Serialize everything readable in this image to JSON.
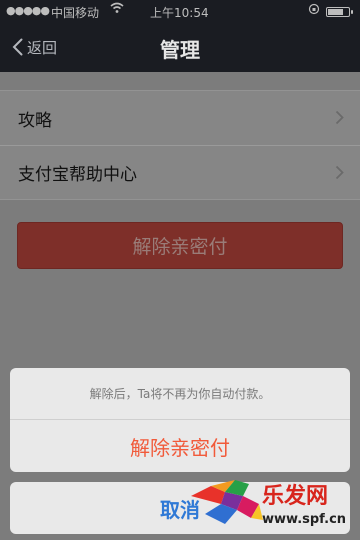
{
  "status_bar": {
    "signal": "●●●●●",
    "carrier": "中国移动",
    "time": "上午10:54",
    "battery_level": 0.75
  },
  "nav": {
    "back_label": "返回",
    "title": "管理"
  },
  "menu": {
    "items": [
      {
        "label": "攻略"
      },
      {
        "label": "支付宝帮助中心"
      }
    ]
  },
  "primary_button": {
    "label": "解除亲密付"
  },
  "action_sheet": {
    "message": "解除后，Ta将不再为你自动付款。",
    "destructive_label": "解除亲密付",
    "cancel_label": "取消"
  },
  "watermark": {
    "brand": "乐发网",
    "url": "www.spf.cn"
  },
  "colors": {
    "nav_bg": "#1a1c22",
    "overlay_bg": "#7c7c7c",
    "destructive": "#f15a3a",
    "cancel": "#2f79d6"
  }
}
